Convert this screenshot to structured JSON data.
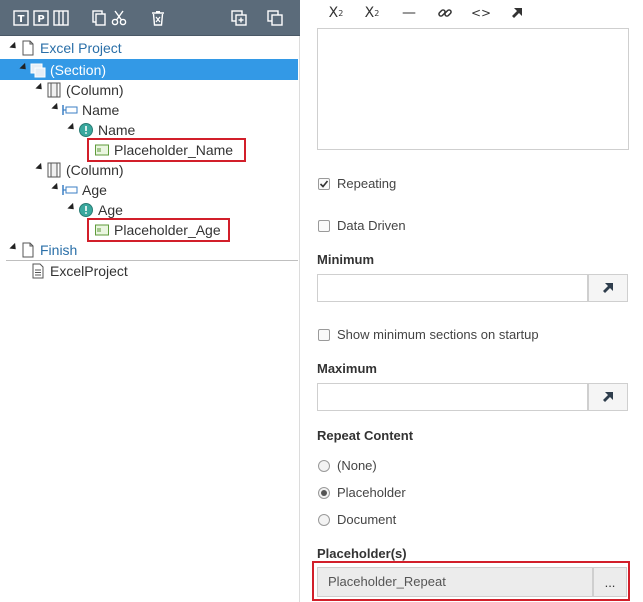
{
  "left_toolbar": {
    "buttons": [
      "text-field-icon",
      "paragraph-icon",
      "columns-icon",
      "copy-icon",
      "cut-icon",
      "delete-icon",
      "add-section-icon",
      "duplicate-icon"
    ]
  },
  "tree": {
    "excel_project": "Excel Project",
    "section": "(Section)",
    "column1": "(Column)",
    "name_group": "Name",
    "name_question": "Name",
    "placeholder_name": "Placeholder_Name",
    "column2": "(Column)",
    "age_group": "Age",
    "age_question": "Age",
    "placeholder_age": "Placeholder_Age",
    "finish": "Finish",
    "excelproject_doc": "ExcelProject"
  },
  "editor_toolbar": {
    "subscript": "X",
    "subscript_mark": "2",
    "superscript": "X",
    "superscript_mark": "2",
    "line": "—",
    "code": "<>"
  },
  "props": {
    "repeating_label": "Repeating",
    "repeating_checked": true,
    "data_driven_label": "Data Driven",
    "data_driven_checked": false,
    "minimum_label": "Minimum",
    "minimum_value": "",
    "show_min_label": "Show minimum sections on startup",
    "show_min_checked": false,
    "maximum_label": "Maximum",
    "maximum_value": "",
    "repeat_content_label": "Repeat Content",
    "repeat_options": [
      "(None)",
      "Placeholder",
      "Document"
    ],
    "repeat_selected": "Placeholder",
    "placeholders_label": "Placeholder(s)",
    "placeholders_value": "Placeholder_Repeat",
    "placeholders_button": "..."
  },
  "colors": {
    "selection": "#3399e6",
    "highlight_border": "#d21f2a",
    "toolbar_bg": "#5b6b7a",
    "link_blue": "#2a6fa8"
  }
}
